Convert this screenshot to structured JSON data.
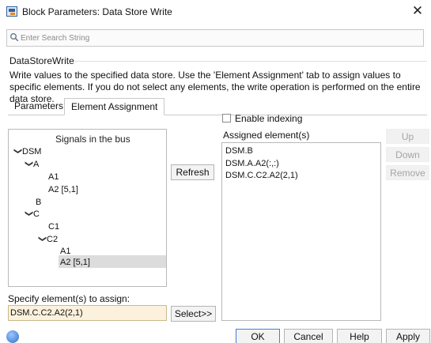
{
  "window": {
    "title": "Block Parameters: Data Store Write",
    "close_glyph": "✕"
  },
  "search": {
    "placeholder": "Enter Search String"
  },
  "block": {
    "name": "DataStoreWrite",
    "description": "Write values to the specified data store. Use the 'Element Assignment' tab to assign values to specific elements. If you do not select any elements, the write operation is performed on the entire data store."
  },
  "tabs": [
    {
      "label": "Parameters",
      "active": false
    },
    {
      "label": "Element Assignment",
      "active": true
    }
  ],
  "tree": {
    "header": "Signals in the bus",
    "items": [
      {
        "label": "DSM",
        "expanded": true,
        "level": 0
      },
      {
        "label": "A",
        "expanded": true,
        "level": 1
      },
      {
        "label": "A1",
        "level": 2
      },
      {
        "label": "A2 [5,1]",
        "level": 2
      },
      {
        "label": "B",
        "level": 1
      },
      {
        "label": "C",
        "expanded": true,
        "level": 1
      },
      {
        "label": "C1",
        "level": 2
      },
      {
        "label": "C2",
        "expanded": true,
        "level": 2
      },
      {
        "label": "A1",
        "level": 3
      },
      {
        "label": "A2 [5,1]",
        "level": 3,
        "selected": true
      }
    ]
  },
  "buttons": {
    "refresh": "Refresh",
    "select": "Select>>",
    "up": "Up",
    "down": "Down",
    "remove": "Remove",
    "ok": "OK",
    "cancel": "Cancel",
    "help": "Help",
    "apply": "Apply"
  },
  "indexing": {
    "label": "Enable indexing",
    "checked": false
  },
  "assigned": {
    "header": "Assigned element(s)",
    "items": [
      "DSM.B",
      "DSM.A.A2(:,:)",
      "DSM.C.C2.A2(2,1)"
    ]
  },
  "specify": {
    "label": "Specify element(s) to assign:",
    "value": "DSM.C.C2.A2(2,1)"
  },
  "colors": {
    "selected_row": "#dcdcdc",
    "specify_input_bg": "#fbf1dc",
    "disabled_text": "#a4a4a4",
    "default_button_border": "#3f7fd9"
  },
  "icons": {
    "app": "simulink-block-icon",
    "search": "search-icon",
    "close": "close-icon",
    "expand": "chevron-down-icon",
    "help": "help-icon"
  }
}
